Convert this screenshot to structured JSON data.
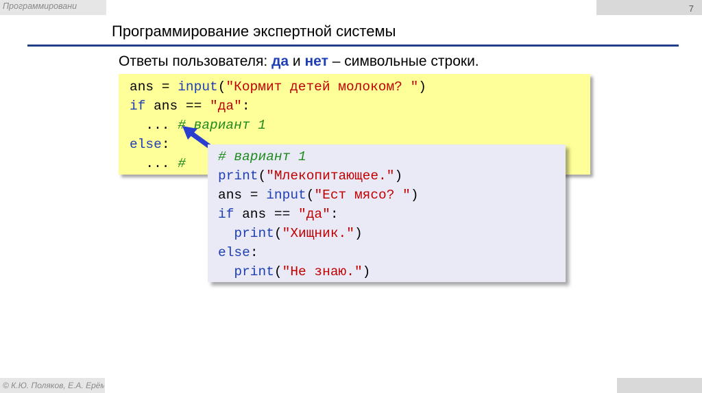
{
  "header": {
    "label": "Программировани",
    "page_number": "7"
  },
  "slide": {
    "title": "Программирование экспертной системы",
    "subtitle": {
      "prefix": "Ответы пользователя: ",
      "yes": "да",
      "middle": " и ",
      "no": "нет",
      "suffix": " – символьные строки."
    }
  },
  "code_main": {
    "l1_var": "ans = ",
    "l1_fn": "input",
    "l1_p1": "(",
    "l1_str": "\"Кормит детей молоком? \"",
    "l1_p2": ")",
    "l2_kw": "if",
    "l2_mid": " ans == ",
    "l2_str": "\"да\"",
    "l2_end": ":",
    "l3_dots": "  ... ",
    "l3_comment": "# вариант 1",
    "l4_kw": "else",
    "l4_end": ":",
    "l5_dots": "  ... ",
    "l5_comment": "#"
  },
  "code_popup": {
    "l1_comment": "# вариант 1",
    "l2_fn": "print",
    "l2_p1": "(",
    "l2_str": "\"Млекопитающее.\"",
    "l2_p2": ")",
    "l3_var": "ans = ",
    "l3_fn": "input",
    "l3_p1": "(",
    "l3_str": "\"Ест мясо? \"",
    "l3_p2": ")",
    "l4_kw": "if",
    "l4_mid": " ans == ",
    "l4_str": "\"да\"",
    "l4_end": ":",
    "l5_indent": "  ",
    "l5_fn": "print",
    "l5_p1": "(",
    "l5_str": "\"Хищник.\"",
    "l5_p2": ")",
    "l6_kw": "else",
    "l6_end": ":",
    "l7_indent": "  ",
    "l7_fn": "print",
    "l7_p1": "(",
    "l7_str": "\"Не знаю.\"",
    "l7_p2": ")"
  },
  "footer": {
    "label": "© К.Ю. Поляков, Е.А. Ерёмин"
  },
  "colors": {
    "keyword": "#1f3fb4",
    "string": "#c00000",
    "comment": "#1e8a1e",
    "code_bg_main": "#ffff99",
    "code_bg_popup": "#eaeaf6",
    "title_rule": "#1f3f8a"
  },
  "icons": {
    "arrow": "arrow-pointer-icon"
  }
}
